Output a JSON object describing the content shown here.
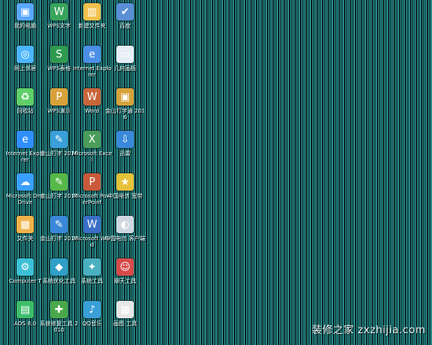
{
  "desktop": {
    "icons": [
      {
        "label": "我的电脑",
        "glyph": "▣",
        "color": "#5aa7ff"
      },
      {
        "label": "网上邻居",
        "glyph": "◎",
        "color": "#4db6ff"
      },
      {
        "label": "回收站",
        "glyph": "♻",
        "color": "#5fcf6a"
      },
      {
        "label": "Internet Explorer",
        "glyph": "e",
        "color": "#2f8fff"
      },
      {
        "label": "Microsoft OneDrive",
        "glyph": "☁",
        "color": "#3aa0ff"
      },
      {
        "label": "文件夹",
        "glyph": "▦",
        "color": "#f0b34a"
      },
      {
        "label": "Computer T",
        "glyph": "⚙",
        "color": "#3cc0d6"
      },
      {
        "label": "AOS 8.0",
        "glyph": "▤",
        "color": "#3dbd6a"
      },
      {
        "label": "WPS文字",
        "glyph": "W",
        "color": "#39a55b"
      },
      {
        "label": "WPS表格",
        "glyph": "S",
        "color": "#2f9a4f"
      },
      {
        "label": "WPS演示",
        "glyph": "P",
        "color": "#d9a13a"
      },
      {
        "label": "金山打字 2010",
        "glyph": "✎",
        "color": "#3aa0d9"
      },
      {
        "label": "金山打字 2010",
        "glyph": "✎",
        "color": "#56b847"
      },
      {
        "label": "金山打字 2010",
        "glyph": "✎",
        "color": "#3a88d9"
      },
      {
        "label": "系统优化工具",
        "glyph": "◆",
        "color": "#2f9fc7"
      },
      {
        "label": "系统修复工具 2010",
        "glyph": "✚",
        "color": "#4aa84a"
      },
      {
        "label": "新建文件夹",
        "glyph": "▥",
        "color": "#f2c14e"
      },
      {
        "label": "Internet Explorer",
        "glyph": "e",
        "color": "#4c8fe6"
      },
      {
        "label": "Word",
        "glyph": "W",
        "color": "#c9653a"
      },
      {
        "label": "Microsoft Excel",
        "glyph": "X",
        "color": "#4a9d5b"
      },
      {
        "label": "Microsoft PowerPoint",
        "glyph": "P",
        "color": "#c85a3a"
      },
      {
        "label": "Microsoft Word",
        "glyph": "W",
        "color": "#3a6fc8"
      },
      {
        "label": "系统工具",
        "glyph": "✦",
        "color": "#4ab0c0"
      },
      {
        "label": "QQ音乐",
        "glyph": "♪",
        "color": "#3a9fd6"
      },
      {
        "label": "百度",
        "glyph": "✔",
        "color": "#5a8fd6"
      },
      {
        "label": "几何画板",
        "glyph": "▭",
        "color": "#e6eef5"
      },
      {
        "label": "金山打字通 2016",
        "glyph": "▣",
        "color": "#d6a23a"
      },
      {
        "label": "迅雷",
        "glyph": "⇩",
        "color": "#3a88d9"
      },
      {
        "label": "中国电信 宽带",
        "glyph": "★",
        "color": "#e6c23a"
      },
      {
        "label": "中国电信 客户端",
        "glyph": "◐",
        "color": "#cfd8e0"
      },
      {
        "label": "聊天工具",
        "glyph": "☺",
        "color": "#d64a4a"
      },
      {
        "label": "画图 工具",
        "glyph": "▦",
        "color": "#e6e6e6"
      }
    ]
  },
  "watermark": {
    "text": "装修之家 zxzhijia.com"
  }
}
